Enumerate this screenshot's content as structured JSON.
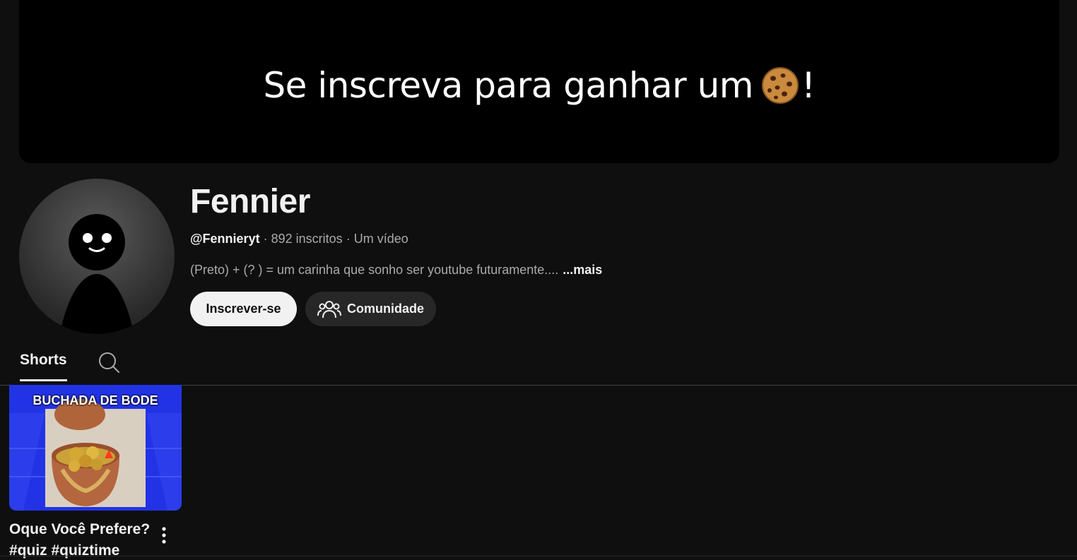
{
  "banner": {
    "text": "Se inscreva para ganhar um",
    "emoji_icon": "cookie-icon",
    "suffix": "!"
  },
  "channel": {
    "name": "Fennier",
    "handle": "@Fennieryt",
    "separator": "·",
    "subscribers": "892 inscritos",
    "videos": "Um vídeo",
    "description": "(Preto) + (? ) = um carinha que sonho ser youtube futuramente....",
    "more_label": "...mais"
  },
  "actions": {
    "subscribe_label": "Inscrever-se",
    "community_label": "Comunidade",
    "community_icon": "community-people-icon"
  },
  "tabs": {
    "items": [
      {
        "label": "Shorts",
        "active": true
      }
    ],
    "search_icon": "search-icon"
  },
  "shorts": [
    {
      "thumbnail_caption": "BUCHADA DE BODE",
      "title": "Oque Você Prefere? #quiz #quiztime"
    }
  ],
  "colors": {
    "background": "#0f0f0f",
    "banner": "#000000",
    "primary_text": "#f1f1f1",
    "secondary_text": "#aaaaaa",
    "subscribe_button": "#f1f1f1",
    "community_button": "#272727",
    "thumbnail_bg": "#1f2ee0"
  }
}
